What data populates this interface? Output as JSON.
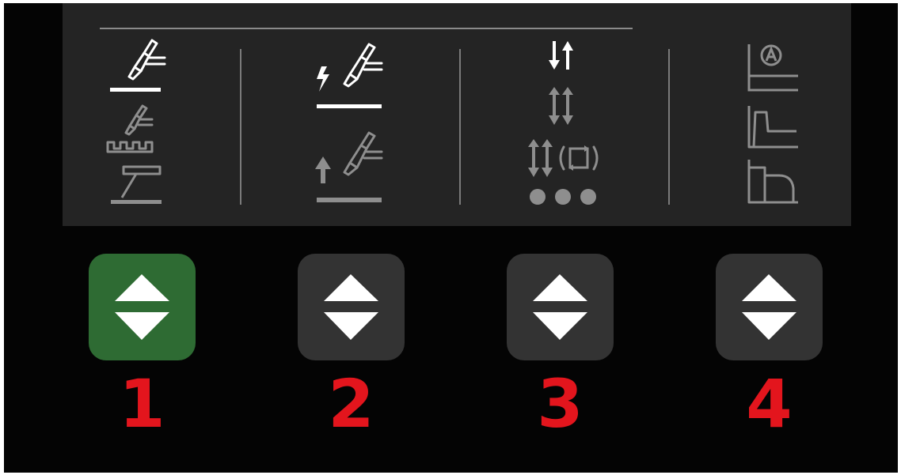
{
  "colors": {
    "panel": "#242424",
    "active": "#ffffff",
    "inactive": "#8e8e8e",
    "button": "#333333",
    "button_active": "#2e6b33",
    "number": "#e3151d"
  },
  "columns": [
    {
      "number": "1",
      "button_state": "selected",
      "icons": [
        "mig-torch-active-icon",
        "pulse-mig-torch-icon",
        "stick-electrode-icon"
      ]
    },
    {
      "number": "2",
      "button_state": "normal",
      "icons": [
        "hf-tig-start-active-icon",
        "lift-tig-start-icon"
      ]
    },
    {
      "number": "3",
      "button_state": "normal",
      "icons": [
        "2t-trigger-active-icon",
        "4t-trigger-icon",
        "4t-repeat-trigger-icon",
        "spot-dots-icon"
      ]
    },
    {
      "number": "4",
      "button_state": "normal",
      "icons": [
        "auto-mode-icon",
        "hot-start-curve-icon",
        "arc-force-curve-icon"
      ]
    }
  ]
}
